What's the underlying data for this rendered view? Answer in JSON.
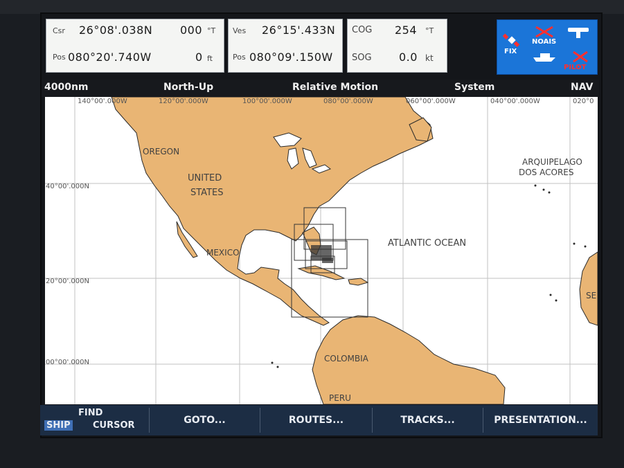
{
  "nav_panels": {
    "cursor": {
      "lat_label": "Csr",
      "lat": "26°08'.038N",
      "bearing": "000",
      "bearing_unit": "°T",
      "pos_label": "Pos",
      "lon": "080°20'.740W",
      "depth": "0",
      "depth_unit": "ft"
    },
    "vessel": {
      "lat_label": "Ves",
      "lat": "26°15'.433N",
      "pos_label": "Pos",
      "lon": "080°09'.150W"
    },
    "motion": {
      "cog_label": "COG",
      "cog": "254",
      "cog_unit": "°T",
      "sog_label": "SOG",
      "sog": "0.0",
      "sog_unit": "kt"
    }
  },
  "status_icons": {
    "fix_label": "FIX",
    "fix_icon": "satellite-icon",
    "noais_label": "NOAIS",
    "noais_icon": "ais-off-icon",
    "radar_icon": "radar-antenna-icon",
    "boat_icon": "vessel-icon",
    "pilot_label": "PILOT",
    "pilot_icon": "autopilot-off-icon",
    "colors": {
      "background": "#1b75d8",
      "alert": "#ff3030"
    }
  },
  "status_bar": {
    "range": "4000nm",
    "orientation": "North-Up",
    "motion_mode": "Relative Motion",
    "datum": "System",
    "mode": "NAV"
  },
  "map": {
    "grid_lon": [
      "140°00'.000W",
      "120°00'.000W",
      "100°00'.000W",
      "080°00'.000W",
      "060°00'.000W",
      "040°00'.000W",
      "020°0"
    ],
    "grid_lat": [
      "40°00'.000N",
      "20°00'.000N",
      "00°00'.000N"
    ],
    "labels": {
      "oregon": "OREGON",
      "united": "UNITED",
      "states": "STATES",
      "mexico": "MEXICO",
      "atlantic": "ATLANTIC OCEAN",
      "arquipelago": "ARQUIPELAGO",
      "dos_acores": "DOS ACORES",
      "colombia": "COLOMBIA",
      "peru": "PERU",
      "se": "SE"
    },
    "colors": {
      "land": "#e8b273",
      "water": "#ffffff",
      "grid": "#bdbdbd"
    }
  },
  "softkeys": {
    "ship": "SHIP",
    "find": "FIND",
    "cursor": "CURSOR",
    "goto": "GOTO...",
    "routes": "ROUTES...",
    "tracks": "TRACKS...",
    "presentation": "PRESENTATION..."
  }
}
